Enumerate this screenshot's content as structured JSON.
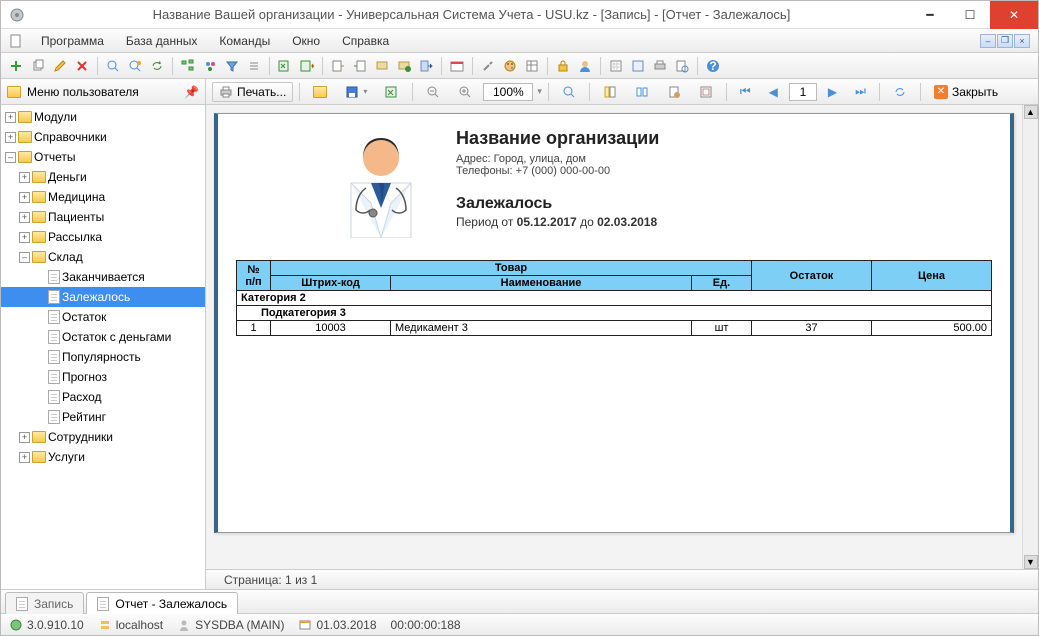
{
  "title": "Название Вашей организации - Универсальная Система Учета - USU.kz - [Запись] - [Отчет - Залежалось]",
  "menu": {
    "program": "Программа",
    "database": "База данных",
    "commands": "Команды",
    "window": "Окно",
    "help": "Справка"
  },
  "sidebar": {
    "header": "Меню пользователя",
    "items": {
      "modules": "Модули",
      "refs": "Справочники",
      "reports": "Отчеты",
      "money": "Деньги",
      "medicine": "Медицина",
      "patients": "Пациенты",
      "mailing": "Рассылка",
      "warehouse": "Склад",
      "runs_out": "Заканчивается",
      "stale": "Залежалось",
      "balance": "Остаток",
      "balance_money": "Остаток с деньгами",
      "popularity": "Популярность",
      "forecast": "Прогноз",
      "expense": "Расход",
      "rating": "Рейтинг",
      "employees": "Сотрудники",
      "services": "Услуги"
    }
  },
  "report_tb": {
    "print": "Печать...",
    "zoom": "100%",
    "page": "1",
    "close": "Закрыть"
  },
  "report": {
    "org_name": "Название организации",
    "address": "Адрес: Город, улица, дом",
    "phones": "Телефоны: +7 (000) 000-00-00",
    "title": "Залежалось",
    "period_lbl": "Период от ",
    "date_from": "05.12.2017",
    "period_mid": " до ",
    "date_to": "02.03.2018",
    "headers": {
      "num": "№ п/п",
      "product": "Товар",
      "barcode": "Штрих-код",
      "name": "Наименование",
      "unit": "Ед.",
      "balance": "Остаток",
      "price": "Цена"
    },
    "group1": "Категория 2",
    "group2": "Подкатегория 3",
    "rows": [
      {
        "n": "1",
        "barcode": "10003",
        "name": "Медикамент 3",
        "unit": "шт",
        "balance": "37",
        "price": "500.00"
      }
    ],
    "page_status": "Страница: 1 из 1"
  },
  "tabs": {
    "record": "Запись",
    "report": "Отчет - Залежалось"
  },
  "status": {
    "version": "3.0.910.10",
    "host": "localhost",
    "user": "SYSDBA (MAIN)",
    "date": "01.03.2018",
    "time": "00:00:00:188"
  }
}
